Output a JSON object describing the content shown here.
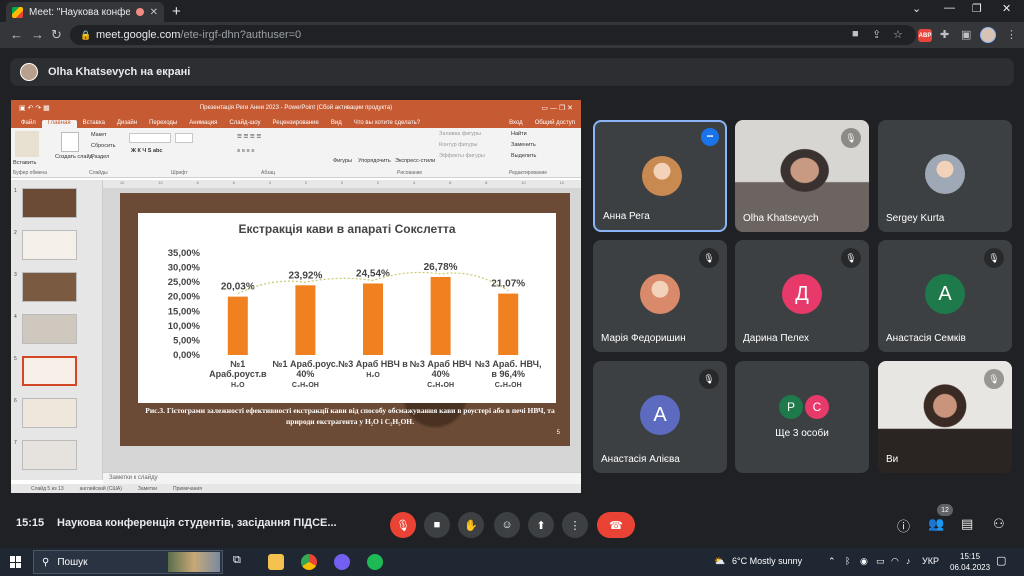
{
  "browser": {
    "tab_title": "Meet: \"Наукова конференці",
    "url_host": "meet.google.com",
    "url_path": "/ete-irgf-dhn?authuser=0",
    "abp_label": "ABP"
  },
  "presenting": {
    "text": "Olha Khatsevych на екрані"
  },
  "powerpoint": {
    "window_title": "Презентація Реги Анни 2023 - PowerPoint (Сбой активации продукта)",
    "user_label": "Вход",
    "share_label": "Общий доступ",
    "menu_tabs": [
      "Файл",
      "Главная",
      "Вставка",
      "Дизайн",
      "Переходы",
      "Анимация",
      "Слайд-шоу",
      "Рецензирование",
      "Вид",
      "Что вы хотите сделать?"
    ],
    "active_tab": "Главная",
    "ribbon": {
      "paste": "Вставить",
      "layout": "Макет",
      "reset": "Сбросить",
      "section": "Раздел",
      "new_slide": "Создать слайд",
      "shapes": "Фигуры",
      "arrange": "Упорядочить",
      "quick_styles": "Экспресс-стили",
      "fill": "Заливка фигуры",
      "outline": "Контур фигуры",
      "effects": "Эффекты фигуры",
      "find": "Найти",
      "replace": "Заменить",
      "select": "Выделить",
      "group_clipboard": "Буфер обмена",
      "group_slides": "Слайды",
      "group_font": "Шрифт",
      "group_paragraph": "Абзац",
      "group_drawing": "Рисование",
      "group_editing": "Редактирование"
    },
    "slide_numbers": [
      "1",
      "2",
      "3",
      "4",
      "5",
      "6",
      "7"
    ],
    "notes_placeholder": "Заметки к слайду",
    "status_items": [
      "Слайд 5 из 13",
      "английский (США)",
      "Заметки",
      "Примечания"
    ],
    "slide": {
      "caption": "Рис.3. Гістограми залежності ефективності екстракції кави від способу обсмажування кави в роустері або в печі НВЧ, та природи екстрагента у H₂O і C₂H₅OH.",
      "number": "5"
    }
  },
  "chart_data": {
    "type": "bar",
    "title": "Екстракція кави в апараті Сокслетта",
    "categories": [
      "№1 Араб.роуст.в H₂O",
      "№1 Араб.роус. 40% C₂H₅OH",
      "№3 Араб НВЧ в H₂O",
      "№3 Араб НВЧ 40% C₂H₅OH",
      "№3 Араб. НВЧ, в 96,4% C₂H₅OH"
    ],
    "category_lines": [
      [
        "№1",
        "Араб.роуст.в",
        "H₂O"
      ],
      [
        "№1 Араб.роус.",
        "40%",
        "C₂H₅OH"
      ],
      [
        "№3 Араб НВЧ в",
        "H₂O"
      ],
      [
        "№3 Араб НВЧ",
        "40%",
        "C₂H₅OH"
      ],
      [
        "№3 Араб. НВЧ,",
        "в 96,4%",
        "C₂H₅OH"
      ]
    ],
    "values": [
      20.03,
      23.92,
      24.54,
      26.78,
      21.07
    ],
    "data_labels": [
      "20,03%",
      "23,92%",
      "24,54%",
      "26,78%",
      "21,07%"
    ],
    "ylim": [
      0,
      35
    ],
    "y_ticks": [
      "0,00%",
      "5,00%",
      "10,00%",
      "15,00%",
      "20,00%",
      "25,00%",
      "30,00%",
      "35,00%"
    ],
    "bar_color": "#f08020",
    "trendline": true,
    "trend_color": "#c8c870",
    "grid": false,
    "xlabel": "",
    "ylabel": ""
  },
  "participants": [
    {
      "name": "Анна Рега",
      "kind": "photo",
      "active": true,
      "mic_off": false,
      "color": "#c98a52"
    },
    {
      "name": "Olha Khatsevych",
      "kind": "camera",
      "active": false,
      "mic_off": true,
      "color": "#8a7a6a"
    },
    {
      "name": "Sergey Kurta",
      "kind": "photo",
      "active": false,
      "mic_off": false,
      "color": "#9fa8b5"
    },
    {
      "name": "Марія Федоришин",
      "kind": "photo",
      "active": false,
      "mic_off": true,
      "color": "#d98a6a"
    },
    {
      "name": "Дарина Пелех",
      "kind": "letter",
      "letter": "Д",
      "active": false,
      "mic_off": true,
      "color": "#e8396b"
    },
    {
      "name": "Анастасія Семків",
      "kind": "letter",
      "letter": "А",
      "active": false,
      "mic_off": true,
      "color": "#1e7a4a"
    },
    {
      "name": "Анастасія Алієва",
      "kind": "letter",
      "letter": "А",
      "active": false,
      "mic_off": true,
      "color": "#5c6bc0"
    },
    {
      "name": "Ще 3 особи",
      "kind": "group",
      "letters": [
        "Р",
        "С"
      ],
      "group_colors": [
        "#1e7a4a",
        "#e8396b"
      ],
      "active": false,
      "mic_off": false
    },
    {
      "name": "Ви",
      "kind": "camera",
      "active": false,
      "mic_off": true,
      "color": "#b0a090"
    }
  ],
  "bottom_bar": {
    "time": "15:15",
    "meeting_title": "Наукова конференція студентів, засідання ПІДСЕ...",
    "participant_count": "12"
  },
  "taskbar": {
    "search_label": "Пошук",
    "weather": "6°C  Mostly sunny",
    "lang": "УКР",
    "time": "15:15",
    "date": "06.04.2023"
  }
}
